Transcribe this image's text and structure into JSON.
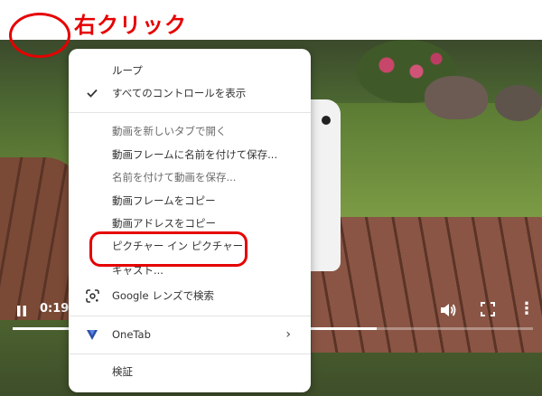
{
  "annotation": {
    "label": "右クリック",
    "color": "#e60000"
  },
  "video": {
    "time_display": "0:19",
    "progress_fraction": 0.7
  },
  "context_menu": {
    "items": [
      {
        "label": "ループ",
        "icon": "",
        "disabled": false
      },
      {
        "label": "すべてのコントロールを表示",
        "icon": "checkmark-icon",
        "disabled": false
      },
      {
        "label": "動画を新しいタブで開く",
        "icon": "",
        "disabled": true
      },
      {
        "label": "動画フレームに名前を付けて保存...",
        "icon": "",
        "disabled": false
      },
      {
        "label": "名前を付けて動画を保存...",
        "icon": "",
        "disabled": true
      },
      {
        "label": "動画フレームをコピー",
        "icon": "",
        "disabled": false
      },
      {
        "label": "動画アドレスをコピー",
        "icon": "",
        "disabled": false
      },
      {
        "label": "ピクチャー イン ピクチャー",
        "icon": "",
        "disabled": false
      },
      {
        "label": "キャスト...",
        "icon": "",
        "disabled": false
      },
      {
        "label": "Google レンズで検索",
        "icon": "google-lens-icon",
        "disabled": false
      },
      {
        "label": "OneTab",
        "icon": "onetab-icon",
        "disabled": false,
        "submenu": true
      },
      {
        "label": "検証",
        "icon": "",
        "disabled": false
      }
    ],
    "highlighted_item": "ピクチャー イン ピクチャー"
  }
}
